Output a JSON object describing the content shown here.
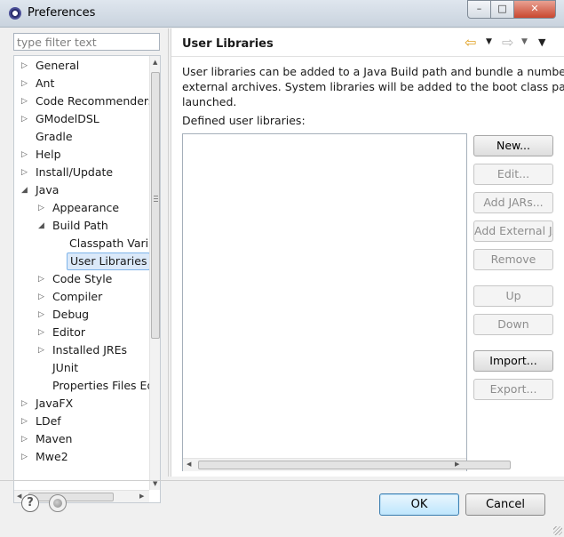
{
  "window": {
    "title": "Preferences",
    "minimize_glyph": "–",
    "maximize_glyph": "□",
    "close_glyph": "✕"
  },
  "filter": {
    "placeholder": "type filter text"
  },
  "tree": {
    "items": [
      {
        "label": "General",
        "depth": 0,
        "expander": "collapsed"
      },
      {
        "label": "Ant",
        "depth": 0,
        "expander": "collapsed"
      },
      {
        "label": "Code Recommenders",
        "depth": 0,
        "expander": "collapsed"
      },
      {
        "label": "GModelDSL",
        "depth": 0,
        "expander": "collapsed"
      },
      {
        "label": "Gradle",
        "depth": 0,
        "expander": "none"
      },
      {
        "label": "Help",
        "depth": 0,
        "expander": "collapsed"
      },
      {
        "label": "Install/Update",
        "depth": 0,
        "expander": "collapsed"
      },
      {
        "label": "Java",
        "depth": 0,
        "expander": "expanded"
      },
      {
        "label": "Appearance",
        "depth": 1,
        "expander": "collapsed"
      },
      {
        "label": "Build Path",
        "depth": 1,
        "expander": "expanded"
      },
      {
        "label": "Classpath Varia",
        "depth": 2,
        "expander": "none"
      },
      {
        "label": "User Libraries",
        "depth": 2,
        "expander": "none",
        "selected": true
      },
      {
        "label": "Code Style",
        "depth": 1,
        "expander": "collapsed"
      },
      {
        "label": "Compiler",
        "depth": 1,
        "expander": "collapsed"
      },
      {
        "label": "Debug",
        "depth": 1,
        "expander": "collapsed"
      },
      {
        "label": "Editor",
        "depth": 1,
        "expander": "collapsed"
      },
      {
        "label": "Installed JREs",
        "depth": 1,
        "expander": "collapsed"
      },
      {
        "label": "JUnit",
        "depth": 1,
        "expander": "none"
      },
      {
        "label": "Properties Files Ed",
        "depth": 1,
        "expander": "none"
      },
      {
        "label": "JavaFX",
        "depth": 0,
        "expander": "collapsed"
      },
      {
        "label": "LDef",
        "depth": 0,
        "expander": "collapsed"
      },
      {
        "label": "Maven",
        "depth": 0,
        "expander": "collapsed"
      },
      {
        "label": "Mwe2",
        "depth": 0,
        "expander": "collapsed"
      }
    ]
  },
  "page": {
    "title": "User Libraries",
    "nav": {
      "back_glyph": "⇦",
      "forward_glyph": "⇨",
      "dropdown_glyph": "▼",
      "menu_glyph": "▼"
    },
    "description": "User libraries can be added to a Java Build path and bundle a number of\nexternal archives. System libraries will be added to the boot class path w\nlaunched.",
    "defined_label": "Defined user libraries:",
    "buttons": [
      {
        "label": "New...",
        "enabled": true
      },
      {
        "label": "Edit...",
        "enabled": false
      },
      {
        "label": "Add JARs...",
        "enabled": false
      },
      {
        "label": "Add External JARs...",
        "enabled": false
      },
      {
        "label": "Remove",
        "enabled": false
      },
      {
        "label": "Up",
        "enabled": false
      },
      {
        "label": "Down",
        "enabled": false
      },
      {
        "label": "Import...",
        "enabled": true
      },
      {
        "label": "Export...",
        "enabled": false
      }
    ]
  },
  "footer": {
    "help_glyph": "?",
    "ok_label": "OK",
    "cancel_label": "Cancel"
  }
}
